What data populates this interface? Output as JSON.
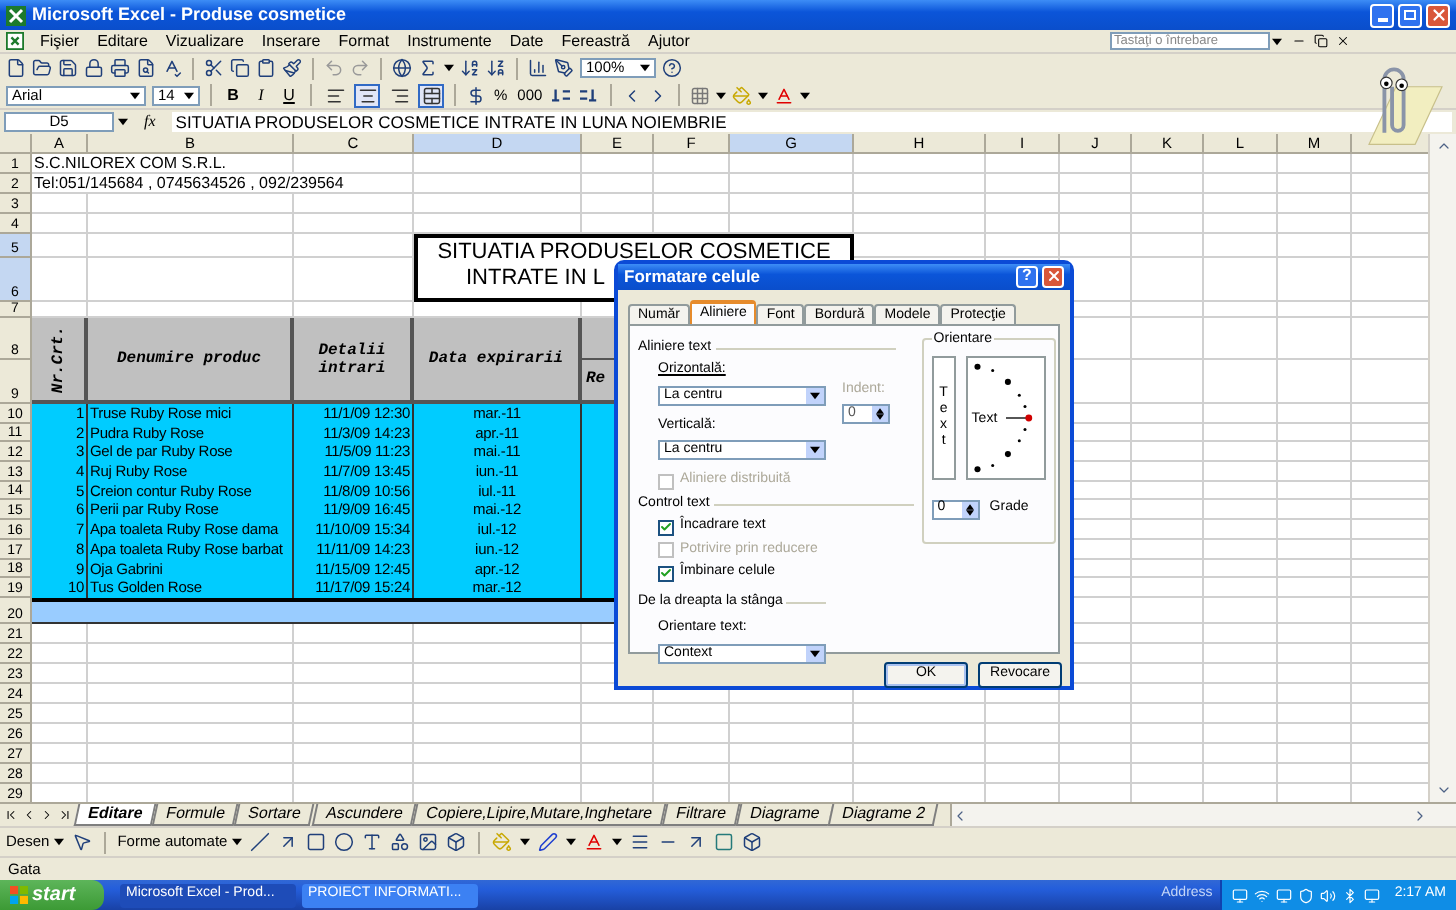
{
  "window": {
    "title": "Microsoft Excel - Produse cosmetice"
  },
  "menu": [
    "Fişier",
    "Editare",
    "Vizualizare",
    "Inserare",
    "Format",
    "Instrumente",
    "Date",
    "Fereastră",
    "Ajutor"
  ],
  "help_search": {
    "placeholder": "Tastaţi o întrebare"
  },
  "standard_toolbar": {
    "zoom": "100%"
  },
  "formatting_toolbar": {
    "font": "Arial",
    "size": "14",
    "style_buttons": [
      "B",
      "I",
      "U"
    ],
    "align_buttons": [
      {
        "kind": "left",
        "selected": false
      },
      {
        "kind": "center",
        "selected": true
      },
      {
        "kind": "right",
        "selected": false
      },
      {
        "kind": "merge",
        "selected": true
      }
    ],
    "number_buttons": [
      "%",
      "000"
    ]
  },
  "formula_bar": {
    "cell": "D5",
    "fx": "fx",
    "value": "SITUATIA PRODUSELOR COSMETICE INTRATE IN LUNA NOIEMBRIE"
  },
  "sheet": {
    "columns": [
      {
        "label": "A",
        "selected": false
      },
      {
        "label": "B",
        "selected": false
      },
      {
        "label": "C",
        "selected": false
      },
      {
        "label": "D",
        "selected": true
      },
      {
        "label": "E",
        "selected": false
      },
      {
        "label": "F",
        "selected": false
      },
      {
        "label": "G",
        "selected": true
      },
      {
        "label": "H",
        "selected": false
      },
      {
        "label": "I",
        "selected": false
      },
      {
        "label": "J",
        "selected": false
      },
      {
        "label": "K",
        "selected": false
      },
      {
        "label": "L",
        "selected": false
      },
      {
        "label": "M",
        "selected": false
      }
    ],
    "rows": [
      {
        "number": "1",
        "selected": false,
        "kind": "text",
        "text": "S.C.NILOREX COM S.R.L."
      },
      {
        "number": "2",
        "selected": false,
        "kind": "text",
        "text": "Tel:051/145684 , 0745634526 , 092/239564"
      },
      {
        "number": "3",
        "selected": false,
        "kind": "blank"
      },
      {
        "number": "4",
        "selected": false,
        "kind": "blank"
      },
      {
        "number": "5",
        "selected": true,
        "kind": "title",
        "lines": [
          "SITUATIA PRODUSELOR COSMETICE",
          "INTRATE IN L"
        ]
      },
      {
        "number": "6",
        "selected": true,
        "kind": "title_cont"
      },
      {
        "number": "7",
        "selected": false,
        "kind": "gap"
      },
      {
        "number": "8",
        "selected": false,
        "kind": "header",
        "cells": [
          "Nr.Crt.",
          "Denumire produc",
          "Detalii intrari",
          "Data expirarii"
        ]
      },
      {
        "number": "9",
        "selected": false,
        "kind": "header_cont",
        "text": "Re"
      },
      {
        "number": "10",
        "selected": false,
        "kind": "data",
        "cells": [
          "1",
          "Truse Ruby Rose mici",
          "11/1/09 12:30",
          "mar.-11"
        ]
      },
      {
        "number": "11",
        "selected": false,
        "kind": "data",
        "cells": [
          "2",
          "Pudra Ruby Rose",
          "11/3/09 14:23",
          "apr.-11"
        ]
      },
      {
        "number": "12",
        "selected": false,
        "kind": "data",
        "cells": [
          "3",
          "Gel de par Ruby Rose",
          "11/5/09 11:23",
          "mai.-11"
        ]
      },
      {
        "number": "13",
        "selected": false,
        "kind": "data",
        "cells": [
          "4",
          "Ruj Ruby Rose",
          "11/7/09 13:45",
          "iun.-11"
        ]
      },
      {
        "number": "14",
        "selected": false,
        "kind": "data",
        "cells": [
          "5",
          "Creion contur Ruby Rose",
          "11/8/09 10:56",
          "iul.-11"
        ]
      },
      {
        "number": "15",
        "selected": false,
        "kind": "data",
        "cells": [
          "6",
          "Perii par Ruby Rose",
          "11/9/09 16:45",
          "mai.-12"
        ]
      },
      {
        "number": "16",
        "selected": false,
        "kind": "data",
        "cells": [
          "7",
          "Apa toaleta Ruby Rose dama",
          "11/10/09 15:34",
          "iul.-12"
        ]
      },
      {
        "number": "17",
        "selected": false,
        "kind": "data",
        "cells": [
          "8",
          "Apa toaleta Ruby Rose barbat",
          "11/11/09 14:23",
          "iun.-12"
        ]
      },
      {
        "number": "18",
        "selected": false,
        "kind": "data",
        "cells": [
          "9",
          "Oja Gabrini",
          "11/15/09 12:45",
          "apr.-12"
        ]
      },
      {
        "number": "19",
        "selected": false,
        "kind": "data",
        "cells": [
          "10",
          "Tus Golden Rose",
          "11/17/09 15:24",
          "mar.-12"
        ]
      },
      {
        "number": "20",
        "selected": false,
        "kind": "total"
      },
      {
        "number": "21",
        "selected": false,
        "kind": "blank"
      },
      {
        "number": "22",
        "selected": false,
        "kind": "blank"
      },
      {
        "number": "23",
        "selected": false,
        "kind": "blank"
      },
      {
        "number": "24",
        "selected": false,
        "kind": "blank"
      },
      {
        "number": "25",
        "selected": false,
        "kind": "blank"
      },
      {
        "number": "26",
        "selected": false,
        "kind": "blank"
      },
      {
        "number": "27",
        "selected": false,
        "kind": "blank"
      },
      {
        "number": "28",
        "selected": false,
        "kind": "blank"
      },
      {
        "number": "29",
        "selected": false,
        "kind": "blank"
      }
    ]
  },
  "dialog": {
    "title": "Formatare celule",
    "help": "?",
    "tabs": [
      {
        "label": "Număr",
        "selected": false
      },
      {
        "label": "Aliniere",
        "selected": true
      },
      {
        "label": "Font",
        "selected": false
      },
      {
        "label": "Bordură",
        "selected": false
      },
      {
        "label": "Modele",
        "selected": false
      },
      {
        "label": "Protecţie",
        "selected": false
      }
    ],
    "text_alignment": {
      "title": "Aliniere text",
      "horizontal_label": "Orizontală:",
      "horizontal": "La centru",
      "vertical_label": "Verticală:",
      "vertical": "La centru",
      "indent": {
        "label": "Indent:",
        "value": "0",
        "disabled": true
      },
      "distributed": {
        "label": "Aliniere distribuită",
        "checked": false,
        "disabled": true
      }
    },
    "text_control": {
      "title": "Control text",
      "options": [
        {
          "label": "Încadrare text",
          "checked": true,
          "disabled": false
        },
        {
          "label": "Potrivire prin reducere",
          "checked": false,
          "disabled": true
        },
        {
          "label": "Îmbinare celule",
          "checked": true,
          "disabled": false
        }
      ]
    },
    "rtl": {
      "title": "De la dreapta la stânga",
      "direction_label": "Orientare text:",
      "direction": "Context"
    },
    "orientation": {
      "title": "Orientare",
      "vertical_text": "Text",
      "dial_text": "Text",
      "degrees": "0",
      "degrees_label": "Grade"
    },
    "buttons": [
      "OK",
      "Revocare"
    ]
  },
  "sheet_tabs": [
    {
      "label": "Editare",
      "selected": true
    },
    {
      "label": "Formule",
      "selected": false
    },
    {
      "label": "Sortare",
      "selected": false
    },
    {
      "label": "Ascundere",
      "selected": false
    },
    {
      "label": "Copiere,Lipire,Mutare,Inghetare",
      "selected": false
    },
    {
      "label": "Filtrare",
      "selected": false
    },
    {
      "label": "Diagrame",
      "selected": false
    },
    {
      "label": "Diagrame 2",
      "selected": false
    }
  ],
  "drawing_toolbar": {
    "draw": "Desen",
    "autoshapes": "Forme automate"
  },
  "status_bar": {
    "text": "Gata"
  },
  "taskbar": {
    "start": "start",
    "tasks": [
      {
        "label": "Microsoft Excel - Prod...",
        "selected": true
      },
      {
        "label": "PROIECT INFORMATI...",
        "selected": false
      }
    ],
    "address": "Address",
    "clock": "2:17 AM"
  }
}
